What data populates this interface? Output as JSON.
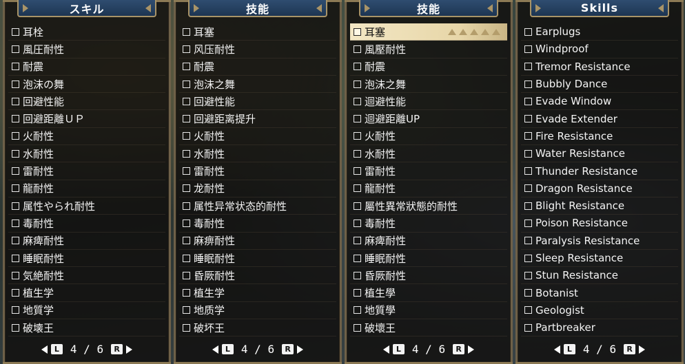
{
  "panels": [
    {
      "title": "スキル",
      "selected_index": -1,
      "items": [
        "耳栓",
        "風圧耐性",
        "耐震",
        "泡沫の舞",
        "回避性能",
        "回避距離ＵＰ",
        "火耐性",
        "水耐性",
        "雷耐性",
        "龍耐性",
        "属性やられ耐性",
        "毒耐性",
        "麻痺耐性",
        "睡眠耐性",
        "気絶耐性",
        "植生学",
        "地質学",
        "破壊王"
      ],
      "pager": {
        "left_key": "L",
        "right_key": "R",
        "page": "4 / 6"
      }
    },
    {
      "title": "技能",
      "selected_index": -1,
      "items": [
        "耳塞",
        "风压耐性",
        "耐震",
        "泡沫之舞",
        "回避性能",
        "回避距离提升",
        "火耐性",
        "水耐性",
        "雷耐性",
        "龙耐性",
        "属性异常状态的耐性",
        "毒耐性",
        "麻痹耐性",
        "睡眠耐性",
        "昏厥耐性",
        "植生学",
        "地质学",
        "破坏王"
      ],
      "pager": {
        "left_key": "L",
        "right_key": "R",
        "page": "4 / 6"
      }
    },
    {
      "title": "技能",
      "selected_index": 0,
      "items": [
        "耳塞",
        "風壓耐性",
        "耐震",
        "泡沫之舞",
        "迴避性能",
        "迴避距離UP",
        "火耐性",
        "水耐性",
        "雷耐性",
        "龍耐性",
        "屬性異常狀態的耐性",
        "毒耐性",
        "麻痺耐性",
        "睡眠耐性",
        "昏厥耐性",
        "植生學",
        "地質學",
        "破壞王"
      ],
      "pager": {
        "left_key": "L",
        "right_key": "R",
        "page": "4 / 6"
      }
    },
    {
      "title": "Skills",
      "selected_index": -1,
      "items": [
        "Earplugs",
        "Windproof",
        "Tremor Resistance",
        "Bubbly Dance",
        "Evade Window",
        "Evade Extender",
        "Fire Resistance",
        "Water Resistance",
        "Thunder Resistance",
        "Dragon Resistance",
        "Blight Resistance",
        "Poison Resistance",
        "Paralysis Resistance",
        "Sleep Resistance",
        "Stun Resistance",
        "Botanist",
        "Geologist",
        "Partbreaker"
      ],
      "pager": {
        "left_key": "L",
        "right_key": "R",
        "page": "4 / 6"
      }
    }
  ],
  "colors": {
    "panel_bg": "#0e0c0a",
    "header_blue": "#2f4d70",
    "frame_gold": "#a99468",
    "selected_bg": "#f3e7c4"
  }
}
